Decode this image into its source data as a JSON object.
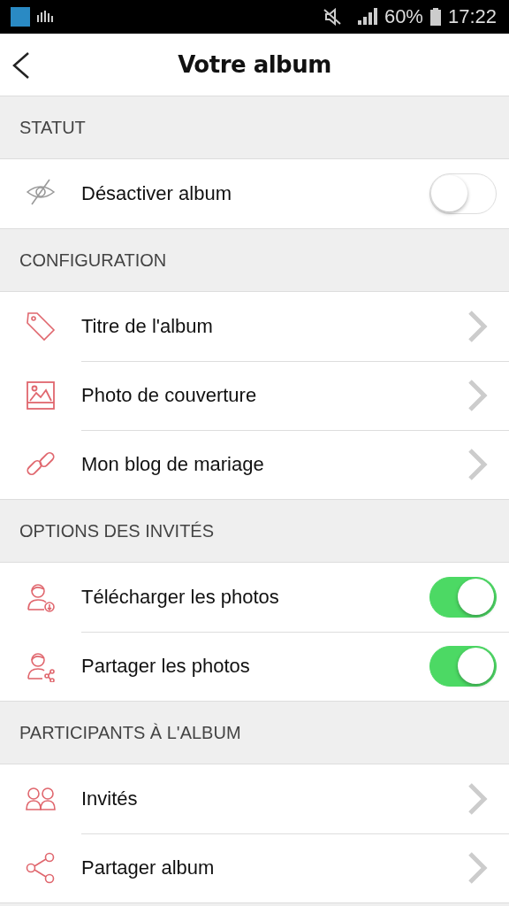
{
  "status_bar": {
    "battery": "60%",
    "time": "17:22"
  },
  "header": {
    "title": "Votre album"
  },
  "sections": [
    {
      "title": "STATUT",
      "rows": [
        {
          "label": "Désactiver album",
          "kind": "toggle",
          "on": false
        }
      ]
    },
    {
      "title": "CONFIGURATION",
      "rows": [
        {
          "label": "Titre de l'album",
          "kind": "link"
        },
        {
          "label": "Photo de couverture",
          "kind": "link"
        },
        {
          "label": "Mon blog de mariage",
          "kind": "link"
        }
      ]
    },
    {
      "title": "OPTIONS DES INVITÉS",
      "rows": [
        {
          "label": "Télécharger les photos",
          "kind": "toggle",
          "on": true
        },
        {
          "label": "Partager les photos",
          "kind": "toggle",
          "on": true
        }
      ]
    },
    {
      "title": "PARTICIPANTS À L'ALBUM",
      "rows": [
        {
          "label": "Invités",
          "kind": "link"
        },
        {
          "label": "Partager album",
          "kind": "link"
        }
      ]
    }
  ]
}
